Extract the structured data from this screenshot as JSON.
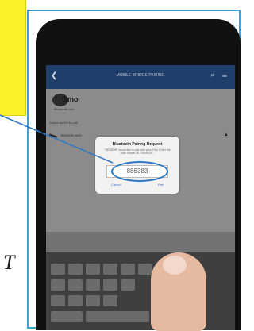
{
  "annotation": {
    "italic_letter": "T",
    "accent_color": "#2f78c4",
    "callout_color": "#fbf22a",
    "frame_color": "#3aa1d6"
  },
  "app": {
    "header_title": "MOBILE BRIDGE PAIRING",
    "back_icon": "chevron-left-icon",
    "brand_logo_text": "Gmo",
    "brand_sub": "Bluetooth Link",
    "section_title": "Select device to pair",
    "device_name": "SENSOR-0001"
  },
  "dialog": {
    "title": "Bluetooth Pairing Request",
    "message": "\"SENSOR\" would like to pair with your iPad. Enter the code shown on \"SENSOR\".",
    "code": "886383",
    "cancel_label": "Cancel",
    "pair_label": "Pair"
  }
}
